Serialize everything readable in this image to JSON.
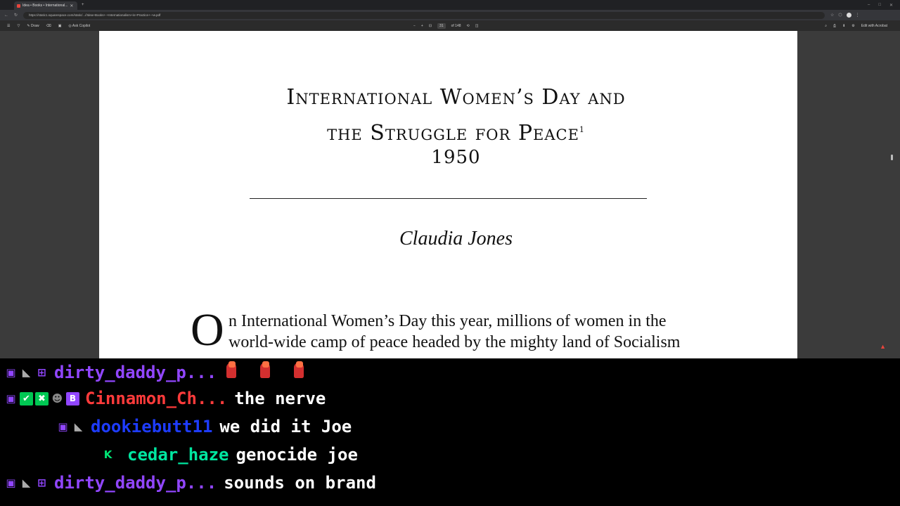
{
  "browser": {
    "tab_title": "Idea • Books • International...",
    "url": "https://static1.squarespace.com/static/...//Idea+Books+-+Internationalism+in+Practice+-+w.pdf",
    "toolbar": {
      "draw_label": "Draw",
      "ask_copilot_label": "Ask Copilot",
      "page_number": "31",
      "page_count": "of 148",
      "edit_acrobat_label": "Edit with Acrobat"
    }
  },
  "document": {
    "title_line1": "International Women’s Day and",
    "title_line2": "the Struggle for Peace",
    "footnote_mark": "1",
    "year": "1950",
    "author": "Claudia Jones",
    "dropcap": "O",
    "body_line1": "n International Women’s Day this year, millions of women in the",
    "body_line2": "world-wide camp of peace headed by the mighty land of Socialism"
  },
  "chat": {
    "messages": [
      {
        "username": "dirty_daddy_p...",
        "color": "#9146ff",
        "badges": [
          "twitch-icon",
          "cat-icon",
          "gift-icon"
        ],
        "text": "",
        "emotes": [
          "raised-fist-emote",
          "raised-fist-emote",
          "raised-fist-emote"
        ]
      },
      {
        "username": "Cinnamon_Ch...",
        "color": "#ff3b3b",
        "badges": [
          "twitch-icon",
          "check-icon",
          "swords-icon",
          "mask-icon",
          "b-icon"
        ],
        "text": "the nerve"
      },
      {
        "username": "dookiebutt11",
        "color": "#1e3cff",
        "badges": [
          "twitch-icon",
          "cat-icon"
        ],
        "text": "we did it Joe"
      },
      {
        "username": "cedar_haze",
        "color": "#00e6a0",
        "badges": [
          "k-icon"
        ],
        "text": "genocide joe"
      },
      {
        "username": "dirty_daddy_p...",
        "color": "#9146ff",
        "badges": [
          "twitch-icon",
          "cat-icon",
          "gift-icon"
        ],
        "text": "sounds on brand"
      }
    ]
  }
}
